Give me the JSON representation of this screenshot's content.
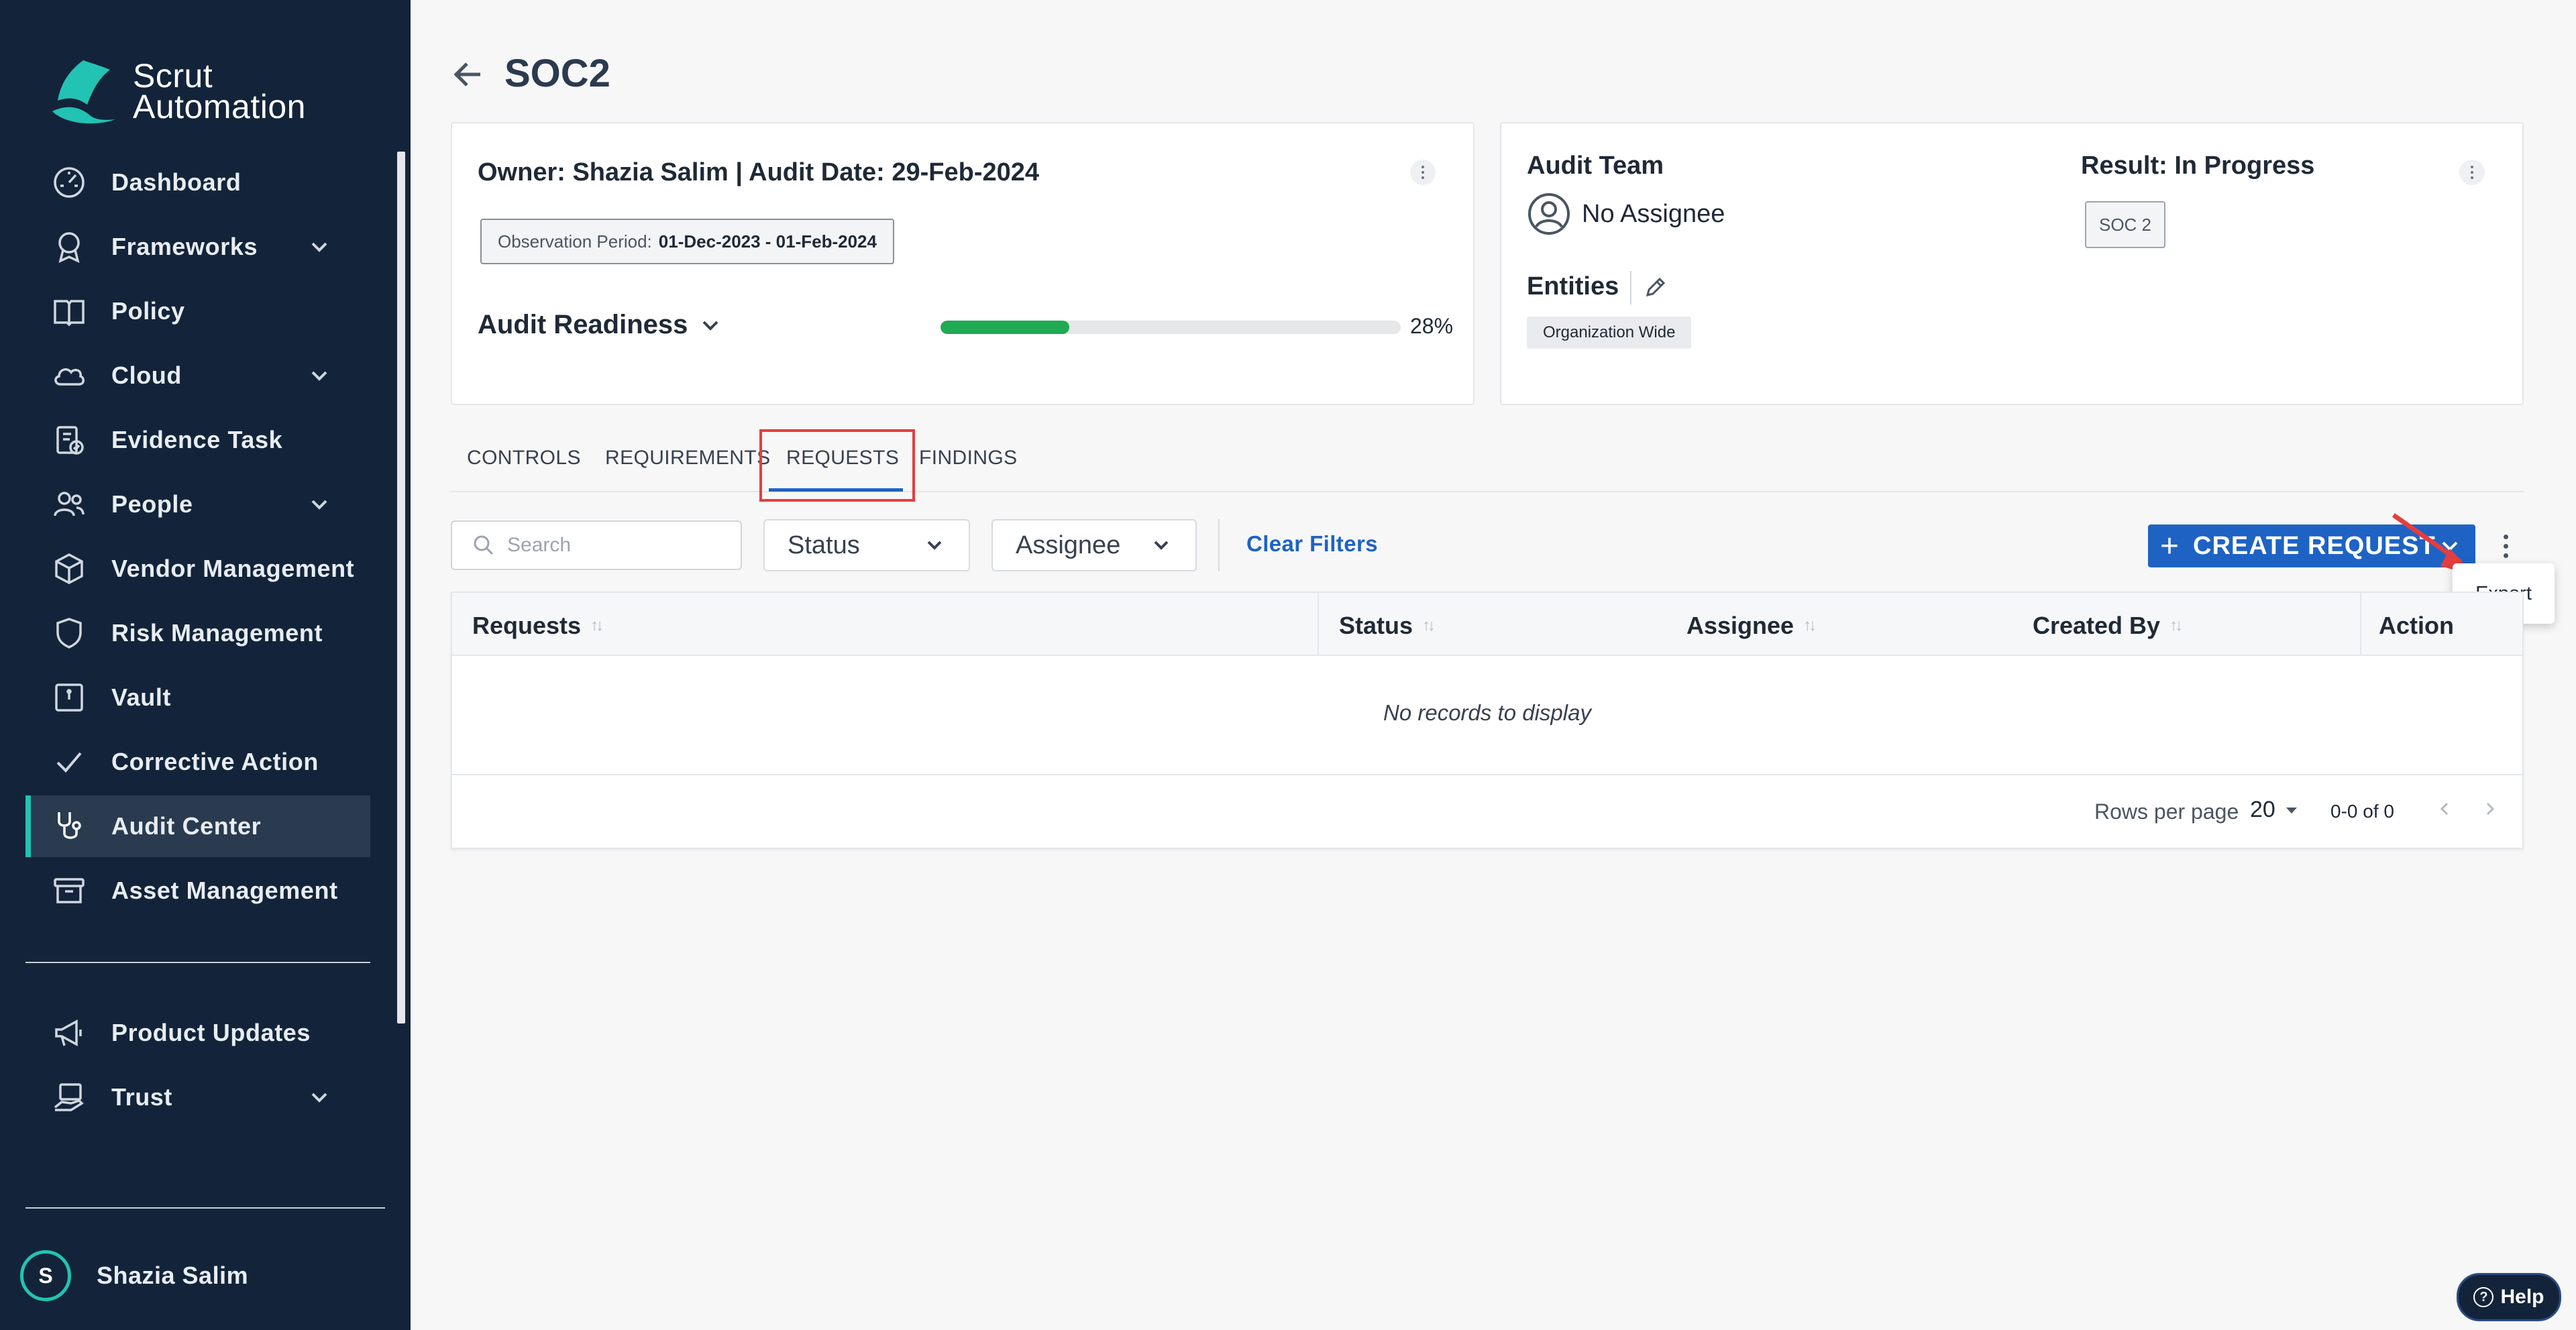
{
  "app": {
    "logo_line1": "Scrut",
    "logo_line2": "Automation",
    "brand_color": "#22c3b3",
    "sidebar_bg": "#13243a",
    "accent": "#1e63c4"
  },
  "sidebar": {
    "items": [
      {
        "label": "Dashboard",
        "icon": "dashboard-gauge-icon",
        "has_chevron": false
      },
      {
        "label": "Frameworks",
        "icon": "award-ribbon-icon",
        "has_chevron": true
      },
      {
        "label": "Policy",
        "icon": "book-icon",
        "has_chevron": false
      },
      {
        "label": "Cloud",
        "icon": "cloud-icon",
        "has_chevron": true
      },
      {
        "label": "Evidence Task",
        "icon": "clipboard-check-icon",
        "has_chevron": false
      },
      {
        "label": "People",
        "icon": "people-icon",
        "has_chevron": true
      },
      {
        "label": "Vendor Management",
        "icon": "box-icon",
        "has_chevron": false
      },
      {
        "label": "Risk Management",
        "icon": "shield-icon",
        "has_chevron": false
      },
      {
        "label": "Vault",
        "icon": "vault-icon",
        "has_chevron": false
      },
      {
        "label": "Corrective Action",
        "icon": "check-icon",
        "has_chevron": false
      },
      {
        "label": "Audit Center",
        "icon": "stethoscope-icon",
        "has_chevron": false,
        "active": true
      },
      {
        "label": "Asset Management",
        "icon": "archive-icon",
        "has_chevron": false
      }
    ],
    "bottom_items": [
      {
        "label": "Product Updates",
        "icon": "megaphone-icon",
        "has_chevron": false
      },
      {
        "label": "Trust",
        "icon": "trust-hand-icon",
        "has_chevron": true
      }
    ],
    "user": {
      "initial": "S",
      "name": "Shazia Salim"
    }
  },
  "header": {
    "title": "SOC2"
  },
  "card_left": {
    "owner_line": "Owner: Shazia Salim | Audit Date: 29-Feb-2024",
    "observation_label": "Observation Period:",
    "observation_value": "01-Dec-2023 - 01-Feb-2024",
    "readiness_label": "Audit Readiness",
    "readiness_percent": 28,
    "readiness_text": "28%"
  },
  "card_right": {
    "audit_team_label": "Audit Team",
    "assignee": "No Assignee",
    "result_label": "Result: In Progress",
    "framework_badge": "SOC 2",
    "entities_label": "Entities",
    "entity_tag": "Organization Wide"
  },
  "tabs": [
    {
      "label": "CONTROLS"
    },
    {
      "label": "REQUIREMENTS"
    },
    {
      "label": "REQUESTS",
      "active": true
    },
    {
      "label": "FINDINGS"
    }
  ],
  "filters": {
    "search_placeholder": "Search",
    "status_label": "Status",
    "assignee_label": "Assignee",
    "clear_label": "Clear Filters",
    "create_label": "CREATE REQUEST",
    "menu_item": "Export"
  },
  "table": {
    "columns": [
      "Requests",
      "Status",
      "Assignee",
      "Created By",
      "Action"
    ],
    "empty_text": "No records to display",
    "rows_per_page_label": "Rows per page",
    "rows_per_page_value": "20",
    "range_text": "0-0 of 0"
  },
  "help": {
    "label": "Help"
  }
}
